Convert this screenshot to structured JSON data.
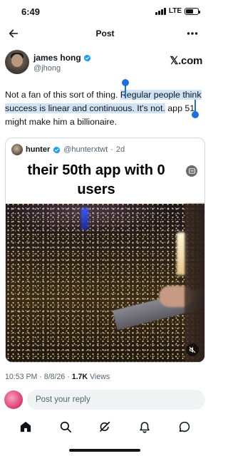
{
  "status_bar": {
    "time": "6:49",
    "network": "LTE",
    "battery_level": 0.65
  },
  "nav": {
    "title": "Post"
  },
  "post": {
    "author_name": "james hong",
    "author_handle": "@jhong",
    "source": "𝕏.com",
    "text_plain": "Not a fan of this sort of thing. ",
    "text_selected_a": "Regular people think success is linear and continuous. It's not.",
    "text_after": " app 51 might make him a billionaire."
  },
  "quote": {
    "author_name": "hunter",
    "author_handle": "@hunterxtwt",
    "separator": "·",
    "age": "2d",
    "video_caption": "their 50th app with 0 users"
  },
  "meta": {
    "time": "10:53 PM",
    "separator": "·",
    "date": "8/8/26",
    "views_count": "1.7K",
    "views_label": "Views"
  },
  "reply": {
    "placeholder": "Post your reply"
  },
  "colors": {
    "accent": "#1d9bf0",
    "selection": "#cfe2f6",
    "text": "#0f1419",
    "secondary": "#536471"
  }
}
